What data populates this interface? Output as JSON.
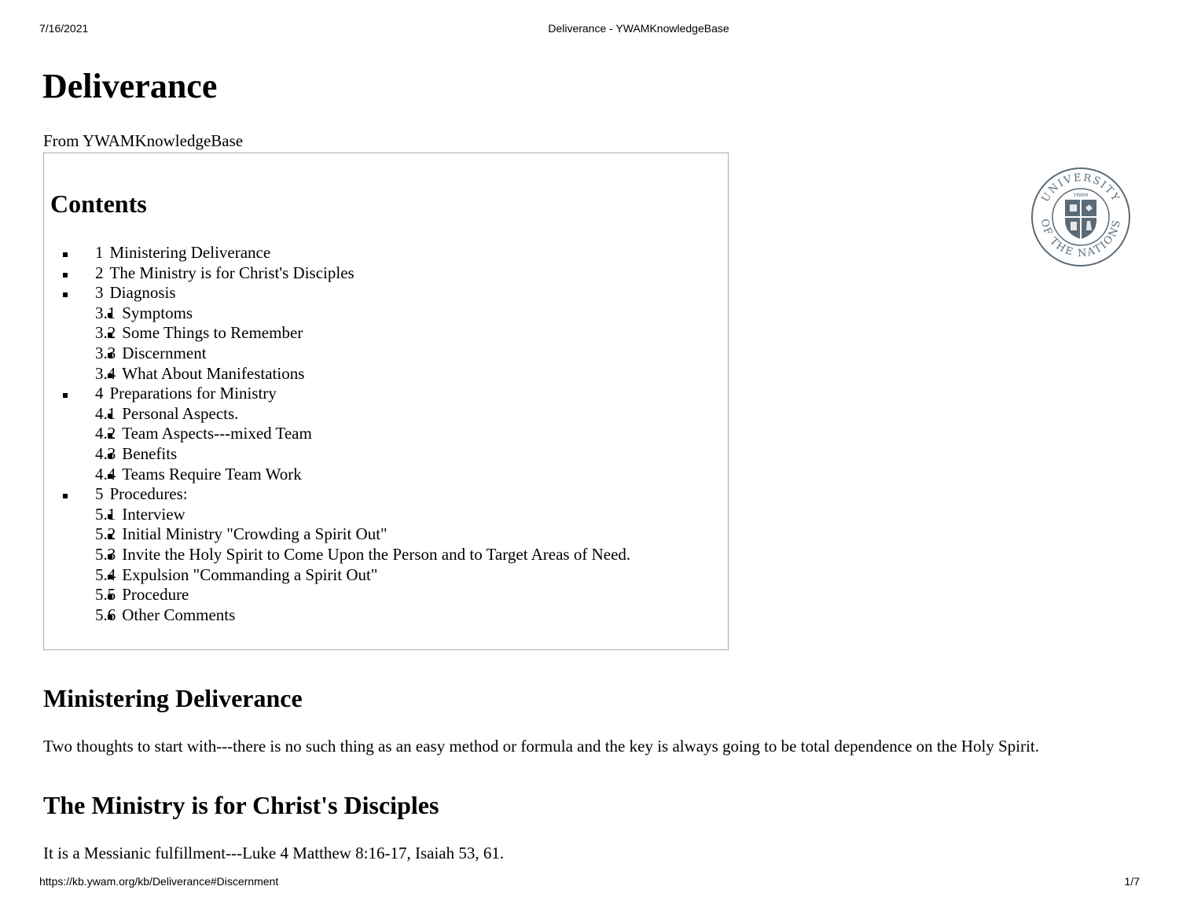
{
  "print_header": {
    "date": "7/16/2021",
    "title": "Deliverance - YWAMKnowledgeBase"
  },
  "print_footer": {
    "url": "https://kb.ywam.org/kb/Deliverance#Discernment",
    "page": "1/7"
  },
  "article": {
    "title": "Deliverance",
    "from": "From YWAMKnowledgeBase"
  },
  "logo": {
    "top_text": "UNIVERSITY",
    "bottom_text": "OF THE NATIONS",
    "inner_text": "YWAM",
    "color": "#5a6b78"
  },
  "toc": {
    "heading": "Contents",
    "items": [
      {
        "num": "1",
        "label": "Ministering Deliverance",
        "children": []
      },
      {
        "num": "2",
        "label": "The Ministry is for Christ's Disciples",
        "children": []
      },
      {
        "num": "3",
        "label": "Diagnosis",
        "children": [
          {
            "num": "3.1",
            "label": "Symptoms"
          },
          {
            "num": "3.2",
            "label": "Some Things to Remember"
          },
          {
            "num": "3.3",
            "label": "Discernment"
          },
          {
            "num": "3.4",
            "label": "What About Manifestations"
          }
        ]
      },
      {
        "num": "4",
        "label": "Preparations for Ministry",
        "children": [
          {
            "num": "4.1",
            "label": "Personal Aspects."
          },
          {
            "num": "4.2",
            "label": "Team Aspects---mixed Team"
          },
          {
            "num": "4.3",
            "label": "Benefits"
          },
          {
            "num": "4.4",
            "label": "Teams Require Team Work"
          }
        ]
      },
      {
        "num": "5",
        "label": "Procedures:",
        "children": [
          {
            "num": "5.1",
            "label": "Interview"
          },
          {
            "num": "5.2",
            "label": "Initial Ministry \"Crowding a Spirit Out\""
          },
          {
            "num": "5.3",
            "label": "Invite the Holy Spirit to Come Upon the Person and to Target Areas of Need."
          },
          {
            "num": "5.4",
            "label": "Expulsion \"Commanding a Spirit Out\""
          },
          {
            "num": "5.5",
            "label": "Procedure"
          },
          {
            "num": "5.6",
            "label": "Other Comments"
          }
        ]
      }
    ]
  },
  "sections": [
    {
      "heading": "Ministering Deliverance",
      "text": "Two thoughts to start with---there is no such thing as an easy method or formula and the key is always going to be total dependence on the Holy Spirit."
    },
    {
      "heading": "The Ministry is for Christ's Disciples",
      "text": "It is a Messianic fulfillment---Luke 4 Matthew 8:16-17, Isaiah 53, 61."
    }
  ]
}
